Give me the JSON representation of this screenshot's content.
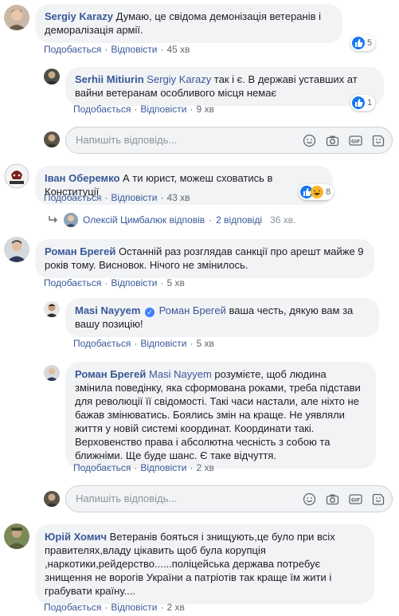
{
  "labels": {
    "like": "Подобається",
    "reply": "Відповісти",
    "dot": "·"
  },
  "reply_placeholder": "Напишіть відповідь...",
  "c1": {
    "author": "Sergiy Karazy",
    "text": "Думаю, це свідома демонізація ветеранів і деморалізація армії.",
    "time": "45 хв",
    "reactions": "5"
  },
  "c1r1": {
    "author": "Serhii Mitiurin",
    "mention": "Sergiy Karazy",
    "text": "так і є. В державі уставших ат вайни ветеранам особливого місця немає",
    "time": "9 хв",
    "reactions": "1"
  },
  "c2": {
    "author": "Іван Оберемко",
    "text": "А ти юрист, можеш сховатись в Конституції",
    "time": "43 хв",
    "reactions": "8"
  },
  "c2_replies": {
    "name": "Олексій Цимбалюк відповів",
    "count": "2 відповіді",
    "time": "36 хв."
  },
  "c3": {
    "author": "Роман Брегей",
    "text": "Останній раз розглядав санкції про арешт майже 9 років тому. Висновок. Нічого не змінилось.",
    "time": "5 хв"
  },
  "c3r1": {
    "author": "Masi Nayyem",
    "mention": "Роман Брегей",
    "text": "ваша честь, дякую вам за вашу позицію!",
    "time": "5 хв"
  },
  "c3r2": {
    "author": "Роман Брегей",
    "mention": "Masi Nayyem",
    "text": "розумієте, щоб людина змінила поведінку, яка сформована роками, треба підстави для революції її свідомості. Такі часи настали, але ніхто не бажав змінюватись. Боялись змін на краще. Не уявляли життя у новій системі координат. Координати такі. Верховенство права і абсолютна чесність з собою та ближніми. Ще буде шанс. Є таке відчуття.",
    "time": "2 хв"
  },
  "c4": {
    "author": "Юрій Хомич",
    "text": "Ветеранів бояться і знищують,це було при всіх правителях,владу цікавить щоб була корупція ,наркотики,рейдерство......поліцейська держава потребує знищення не ворогів України а патріотів так краще їм жити і грабувати країну....",
    "time": "2 хв"
  },
  "colors": {
    "link": "#385898",
    "bubble": "#f2f3f5",
    "like_blue": "#1877f2",
    "meta": "#606770"
  }
}
